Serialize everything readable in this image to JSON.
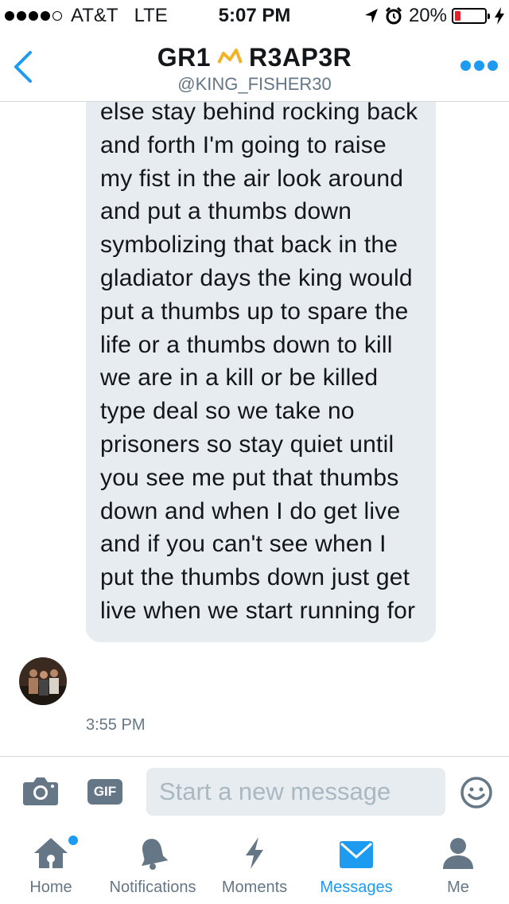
{
  "status_bar": {
    "carrier": "AT&T",
    "network": "LTE",
    "time": "5:07 PM",
    "battery": "20%",
    "battery_level": 0.2,
    "battery_color": "#e0232a"
  },
  "header": {
    "name_part1": "GR1",
    "name_part2": "R3AP3R",
    "handle": "@KING_FISHER30",
    "back_icon": "chevron-left-icon",
    "more_icon": "more-dots-icon",
    "accent": "#1d9bf0"
  },
  "conversation": {
    "message_text": "else stay behind rocking back and forth I'm going to raise my fist in the air look around and put a thumbs down symbolizing that back in the gladiator days the king would put a thumbs up to spare the life or a thumbs down to kill we are in a kill or be killed type deal so we take no prisoners so stay quiet until you see me put that thumbs down and when I do get live and if you can't see when I put the thumbs down just get live when we start running for",
    "timestamp": "3:55 PM"
  },
  "composer": {
    "placeholder": "Start a new message",
    "gif_label": "GIF"
  },
  "tabs": [
    {
      "label": "Home",
      "icon": "home-icon",
      "active": false
    },
    {
      "label": "Notifications",
      "icon": "bell-icon",
      "active": false
    },
    {
      "label": "Moments",
      "icon": "lightning-icon",
      "active": false
    },
    {
      "label": "Messages",
      "icon": "envelope-icon",
      "active": true
    },
    {
      "label": "Me",
      "icon": "person-icon",
      "active": false
    }
  ]
}
